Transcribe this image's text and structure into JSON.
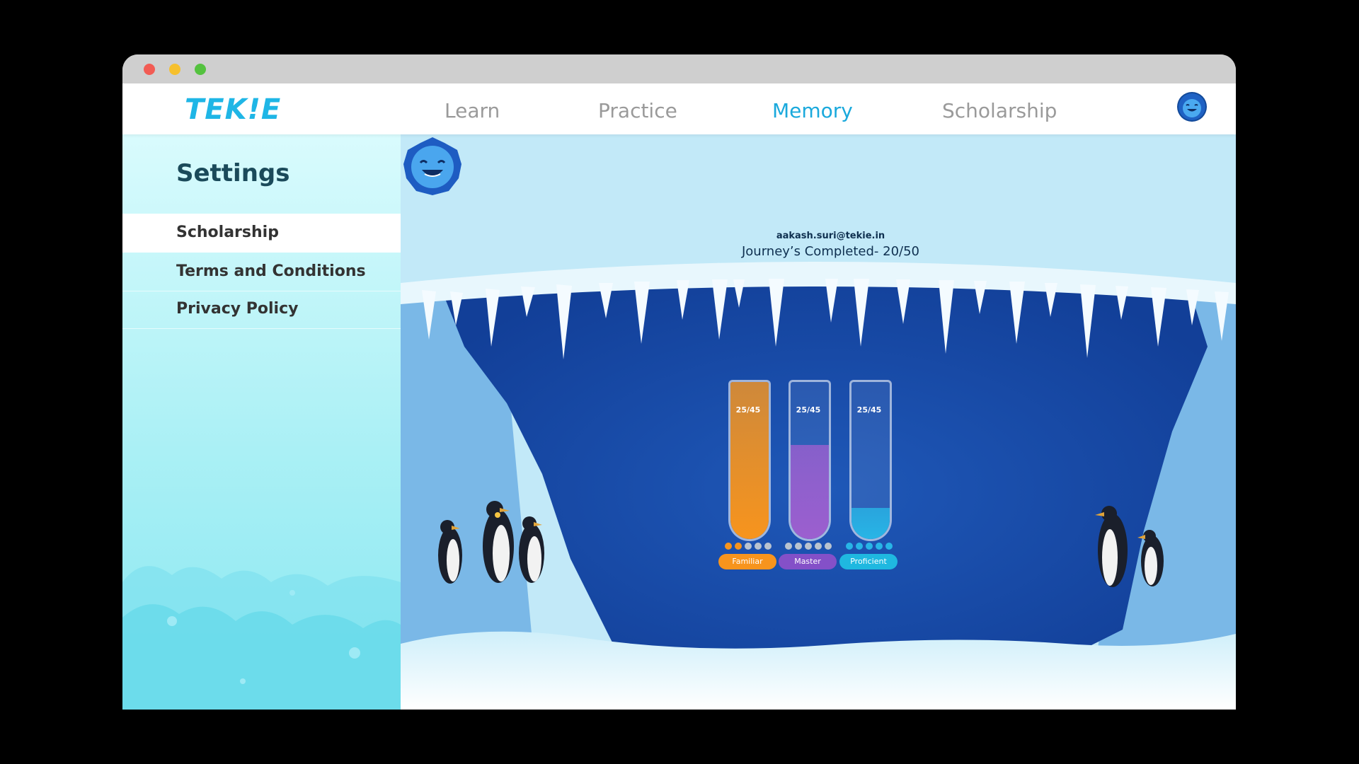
{
  "window": {
    "controls": [
      "close",
      "minimize",
      "maximize"
    ]
  },
  "navbar": {
    "logo": "TEK!E",
    "tabs": [
      {
        "label": "Learn",
        "active": false
      },
      {
        "label": "Practice",
        "active": false
      },
      {
        "label": "Memory",
        "active": true
      },
      {
        "label": "Scholarship",
        "active": false
      }
    ],
    "avatar_icon": "blue-blob-avatar-icon"
  },
  "sidebar": {
    "title": "Settings",
    "items": [
      {
        "label": "Scholarship",
        "active": true
      },
      {
        "label": "Terms and Conditions",
        "active": false
      },
      {
        "label": "Privacy Policy",
        "active": false
      }
    ]
  },
  "profile": {
    "email": "aakash.suri@tekie.in",
    "journeys": "Journey’s Completed- 20/50"
  },
  "tubes": [
    {
      "value": "25/45",
      "level": 1.0,
      "badge": "Familiar",
      "color": "#f7941d",
      "badge_color": "#f7941d",
      "dots_filled": 2,
      "dots_total": 5
    },
    {
      "value": "25/45",
      "level": 0.6,
      "badge": "Master",
      "color": "#9c5fcf",
      "badge_color": "#8450c8",
      "dots_filled": 0,
      "dots_total": 5
    },
    {
      "value": "25/45",
      "level": 0.2,
      "badge": "Proficient",
      "color": "#28b5e6",
      "badge_color": "#1fb8e0",
      "dots_filled": 5,
      "dots_total": 5
    }
  ],
  "colors": {
    "accent": "#1aa9dc",
    "nav_inactive": "#9a9a9a",
    "cave": "#1c4fae"
  }
}
